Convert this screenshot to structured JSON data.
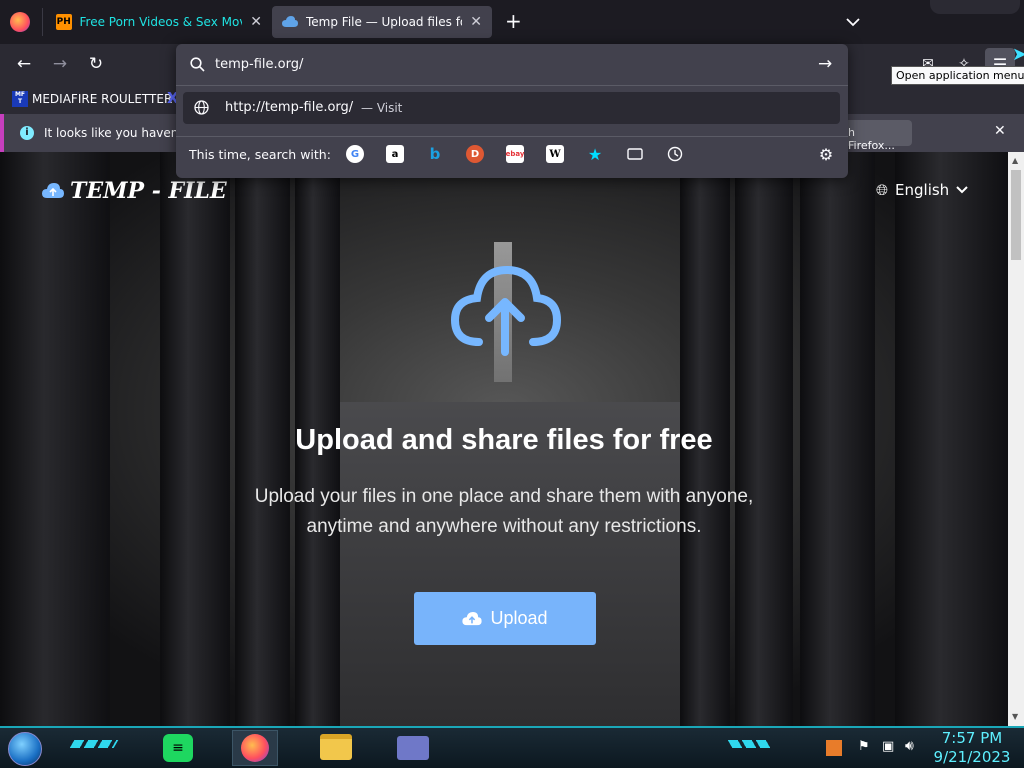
{
  "tabs": [
    {
      "label": "Free Porn Videos & Sex Movies",
      "favicon": "PH",
      "active": false
    },
    {
      "label": "Temp File — Upload files for fre",
      "active": true
    }
  ],
  "urlbar": {
    "value": "temp-file.org/",
    "suggestion_url": "http://temp-file.org/",
    "suggestion_action": "— Visit",
    "search_with_label": "This time, search with:"
  },
  "bookmarks": {
    "item1": "MEDIAFIRE ROULETTER",
    "item1_icon": "MF T"
  },
  "notice": {
    "text": "It looks like you haven't s",
    "right_text": "h Firefox..."
  },
  "tooltip": "Open application menu",
  "site": {
    "logo": "TEMP - FILE",
    "language": "English",
    "headline": "Upload and share files for free",
    "subtext_line1": "Upload your files in one place and share them with anyone,",
    "subtext_line2": "anytime and anywhere without any restrictions.",
    "upload_button": "Upload"
  },
  "taskbar": {
    "time": "7:57 PM",
    "date": "9/21/2023"
  },
  "colors": {
    "accent_blue": "#77b7ff",
    "button_blue": "#78b4fb",
    "taskbar_teal": "#1aa7b8"
  }
}
